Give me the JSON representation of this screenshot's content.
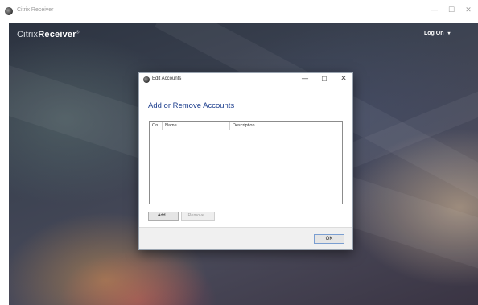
{
  "window": {
    "title": "Citrix Receiver",
    "minimize": "—",
    "maximize": "☐",
    "close": "✕"
  },
  "app": {
    "brand_prefix": "Citrix",
    "brand_name": "Receiver",
    "brand_mark": "®",
    "logon_label": "Log On",
    "logon_caret": "▾"
  },
  "dialog": {
    "title": "Edit Accounts",
    "minimize": "—",
    "maximize": "☐",
    "close": "✕",
    "heading": "Add or Remove Accounts",
    "columns": [
      "On",
      "Name",
      "Description"
    ],
    "rows": [],
    "add_label": "Add...",
    "remove_label": "Remove...",
    "ok_label": "OK"
  }
}
